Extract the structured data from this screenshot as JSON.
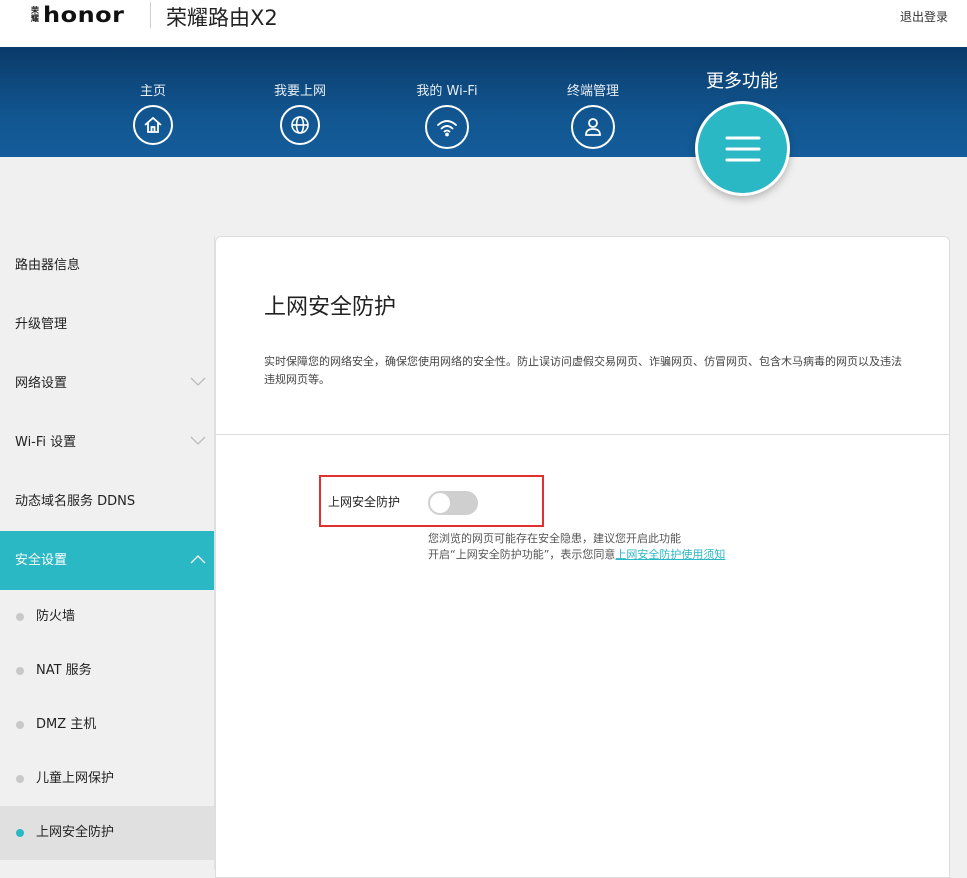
{
  "header": {
    "logo_cn": "荣耀",
    "logo_en": "honor",
    "product": "荣耀路由X2",
    "logout": "退出登录"
  },
  "nav": {
    "items": [
      {
        "label": "主页",
        "icon": "home-icon"
      },
      {
        "label": "我要上网",
        "icon": "globe-icon"
      },
      {
        "label": "我的 Wi-Fi",
        "icon": "wifi-icon"
      },
      {
        "label": "终端管理",
        "icon": "user-icon"
      }
    ],
    "more": {
      "label": "更多功能",
      "icon": "menu-icon"
    },
    "accent": "#2ab8c4"
  },
  "sidebar": {
    "items": [
      {
        "label": "路由器信息"
      },
      {
        "label": "升级管理"
      },
      {
        "label": "网络设置"
      },
      {
        "label": "Wi-Fi 设置"
      },
      {
        "label": "动态域名服务 DDNS"
      },
      {
        "label": "安全设置"
      }
    ],
    "sub_items": [
      {
        "label": "防火墙"
      },
      {
        "label": "NAT 服务"
      },
      {
        "label": "DMZ 主机"
      },
      {
        "label": "儿童上网保护"
      },
      {
        "label": "上网安全防护"
      }
    ]
  },
  "content": {
    "title": "上网安全防护",
    "description": "实时保障您的网络安全，确保您使用网络的安全性。防止误访问虚假交易网页、诈骗网页、仿冒网页、包含木马病毒的网页以及违法违规网页等。",
    "setting_label": "上网安全防护",
    "toggle_on": false,
    "note1": "您浏览的网页可能存在安全隐患，建议您开启此功能",
    "note2_prefix": "开启“上网安全防护功能”，表示您同意",
    "note2_link": "上网安全防护使用须知"
  }
}
